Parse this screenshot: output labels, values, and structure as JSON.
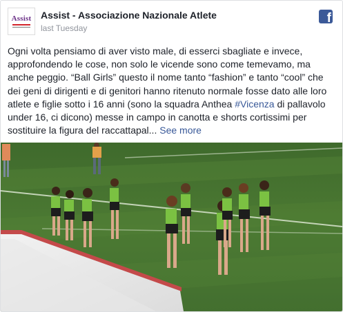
{
  "header": {
    "page_name": "Assist - Associazione Nazionale Atlete",
    "timestamp": "last Tuesday",
    "avatar_text": "Assist",
    "network_icon": "facebook-icon"
  },
  "post": {
    "text_before_hashtag": "Ogni volta pensiamo di aver visto male, di esserci sbagliate e invece, approfondendo le cose, non solo le vicende sono come temevamo, ma anche peggio. “Ball Girls” questo il nome tanto “fashion” e tanto “cool” che dei geni di dirigenti e di genitori hanno ritenuto normale fosse dato alle loro atlete e figlie sotto i 16 anni (sono la squadra Anthea ",
    "hashtag": "#Vicenza",
    "text_after_hashtag": " di pallavolo under 16, ci dicono) messe in campo in canotta e shorts cortissimi per sostituire la figura del raccattapal...",
    "see_more": "See more"
  },
  "colors": {
    "link": "#385898",
    "brand": "#3b5998",
    "text": "#1d2129",
    "muted": "#90949c"
  }
}
